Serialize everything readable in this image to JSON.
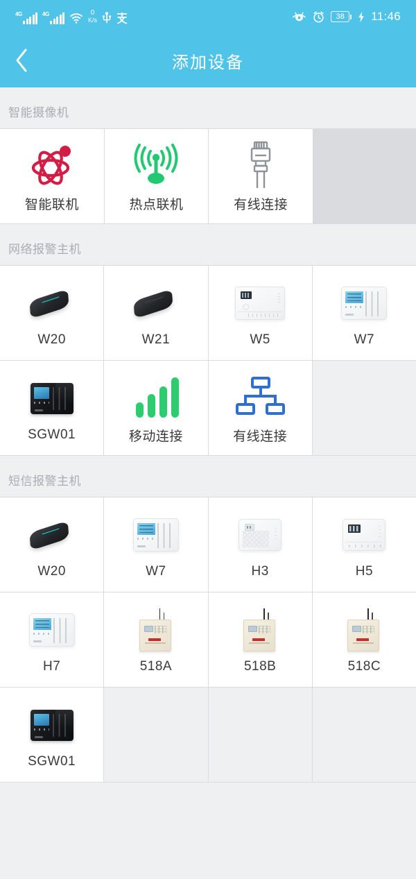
{
  "status_bar": {
    "signal_1_label": "4G",
    "signal_2_label": "4G",
    "wifi_icon": "wifi-icon",
    "net_speed_value": "0",
    "net_speed_unit": "K/s",
    "usb_icon": "usb-icon",
    "alipay_icon": "alipay-icon",
    "eye_comfort_icon": "eye-icon",
    "alarm_icon": "alarm-clock-icon",
    "battery_level": "38",
    "charging_icon": "charging-bolt-icon",
    "time": "11:46"
  },
  "app_bar": {
    "back_icon": "back-chevron-icon",
    "title": "添加设备"
  },
  "theme": {
    "accent": "#4fc3e8",
    "page_bg": "#eef0f2",
    "card_bg": "#ffffff",
    "section_text": "#a9aeb5",
    "label_text": "#3a3a3a",
    "atom_red": "#d21e45",
    "signal_green": "#2ecc71",
    "network_blue": "#2f6fd0",
    "ethernet_gray": "#8d9399"
  },
  "sections": [
    {
      "title": "智能摄像机",
      "columns": 3,
      "items": [
        {
          "label": "智能联机",
          "icon": "atom-smart-link-icon",
          "kind": "icon"
        },
        {
          "label": "热点联机",
          "icon": "hotspot-antenna-icon",
          "kind": "icon"
        },
        {
          "label": "有线连接",
          "icon": "ethernet-plug-icon",
          "kind": "icon"
        }
      ]
    },
    {
      "title": "网络报警主机",
      "columns": 4,
      "items": [
        {
          "label": "W20",
          "icon": "device-hub-w20",
          "kind": "device"
        },
        {
          "label": "W21",
          "icon": "device-hub-w21",
          "kind": "device"
        },
        {
          "label": "W5",
          "icon": "device-panel-w5",
          "kind": "device"
        },
        {
          "label": "W7",
          "icon": "device-panel-w7",
          "kind": "device"
        },
        {
          "label": "SGW01",
          "icon": "device-panel-sgw01",
          "kind": "device"
        },
        {
          "label": "移动连接",
          "icon": "cellular-bars-icon",
          "kind": "icon"
        },
        {
          "label": "有线连接",
          "icon": "network-topology-icon",
          "kind": "icon"
        },
        {
          "label": "",
          "icon": "",
          "kind": "filler"
        }
      ]
    },
    {
      "title": "短信报警主机",
      "columns": 4,
      "items": [
        {
          "label": "W20",
          "icon": "device-hub-w20",
          "kind": "device"
        },
        {
          "label": "W7",
          "icon": "device-panel-w7",
          "kind": "device"
        },
        {
          "label": "H3",
          "icon": "device-panel-h3",
          "kind": "device"
        },
        {
          "label": "H5",
          "icon": "device-panel-h5",
          "kind": "device"
        },
        {
          "label": "H7",
          "icon": "device-panel-h7",
          "kind": "device"
        },
        {
          "label": "518A",
          "icon": "device-panel-518a",
          "kind": "device"
        },
        {
          "label": "518B",
          "icon": "device-panel-518b",
          "kind": "device"
        },
        {
          "label": "518C",
          "icon": "device-panel-518c",
          "kind": "device"
        },
        {
          "label": "SGW01",
          "icon": "device-panel-sgw01",
          "kind": "device"
        },
        {
          "label": "",
          "icon": "",
          "kind": "filler"
        },
        {
          "label": "",
          "icon": "",
          "kind": "filler"
        },
        {
          "label": "",
          "icon": "",
          "kind": "filler"
        }
      ]
    }
  ]
}
